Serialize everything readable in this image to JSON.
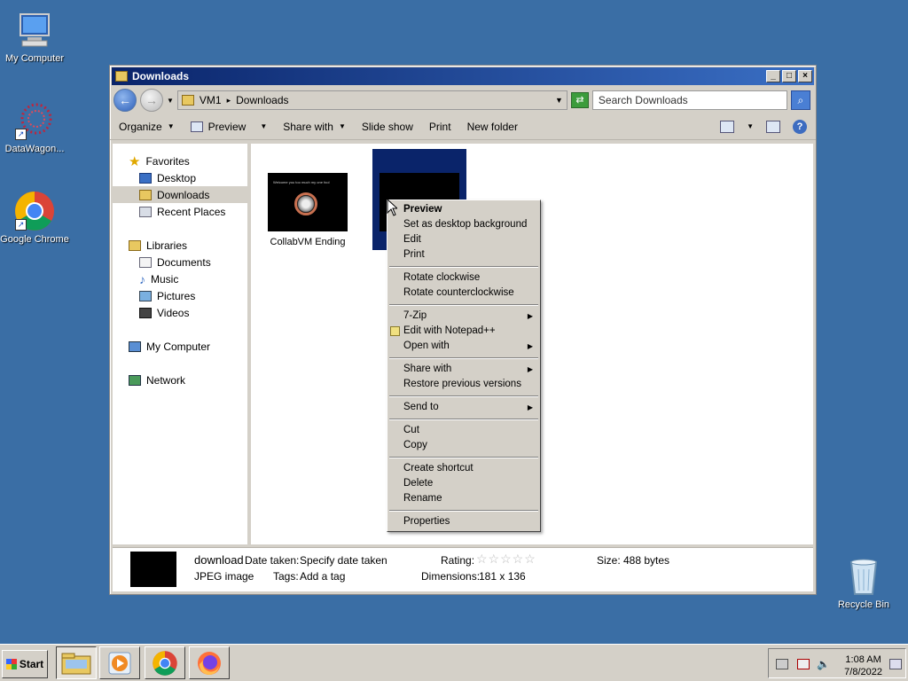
{
  "desktop": {
    "icons": [
      {
        "label": "My Computer"
      },
      {
        "label": "DataWagon..."
      },
      {
        "label": "Google Chrome"
      },
      {
        "label": "Recycle Bin"
      }
    ]
  },
  "window": {
    "title": "Downloads",
    "address": {
      "root": "VM1",
      "sep": "▸",
      "folder": "Downloads"
    },
    "search_placeholder": "Search Downloads",
    "toolbar": {
      "organize": "Organize",
      "preview": "Preview",
      "share_with": "Share with",
      "slide_show": "Slide show",
      "print": "Print",
      "new_folder": "New folder"
    },
    "nav": {
      "favorites": "Favorites",
      "desktop": "Desktop",
      "downloads": "Downloads",
      "recent_places": "Recent Places",
      "libraries": "Libraries",
      "documents": "Documents",
      "music": "Music",
      "pictures": "Pictures",
      "videos": "Videos",
      "my_computer": "My Computer",
      "network": "Network"
    },
    "files": [
      {
        "name": "CollabVM Ending",
        "thumb_caption": "Welcome you too much my one fool"
      },
      {
        "name": ""
      }
    ],
    "details": {
      "filename": "download",
      "filetype": "JPEG image",
      "date_taken_label": "Date taken:",
      "date_taken_value": "Specify date taken",
      "tags_label": "Tags:",
      "tags_value": "Add a tag",
      "rating_label": "Rating:",
      "rating_stars": "☆☆☆☆☆",
      "dimensions_label": "Dimensions:",
      "dimensions_value": "181 x 136",
      "size_label": "Size:",
      "size_value": "488 bytes"
    }
  },
  "context_menu": {
    "preview": "Preview",
    "set_desktop_bg": "Set as desktop background",
    "edit": "Edit",
    "print": "Print",
    "rotate_cw": "Rotate clockwise",
    "rotate_ccw": "Rotate counterclockwise",
    "seven_zip": "7-Zip",
    "edit_notepad": "Edit with Notepad++",
    "open_with": "Open with",
    "share_with": "Share with",
    "restore_versions": "Restore previous versions",
    "send_to": "Send to",
    "cut": "Cut",
    "copy": "Copy",
    "create_shortcut": "Create shortcut",
    "delete": "Delete",
    "rename": "Rename",
    "properties": "Properties",
    "submenu_arrow": "▶"
  },
  "taskbar": {
    "start": "Start",
    "time": "1:08 AM",
    "date": "7/8/2022"
  }
}
